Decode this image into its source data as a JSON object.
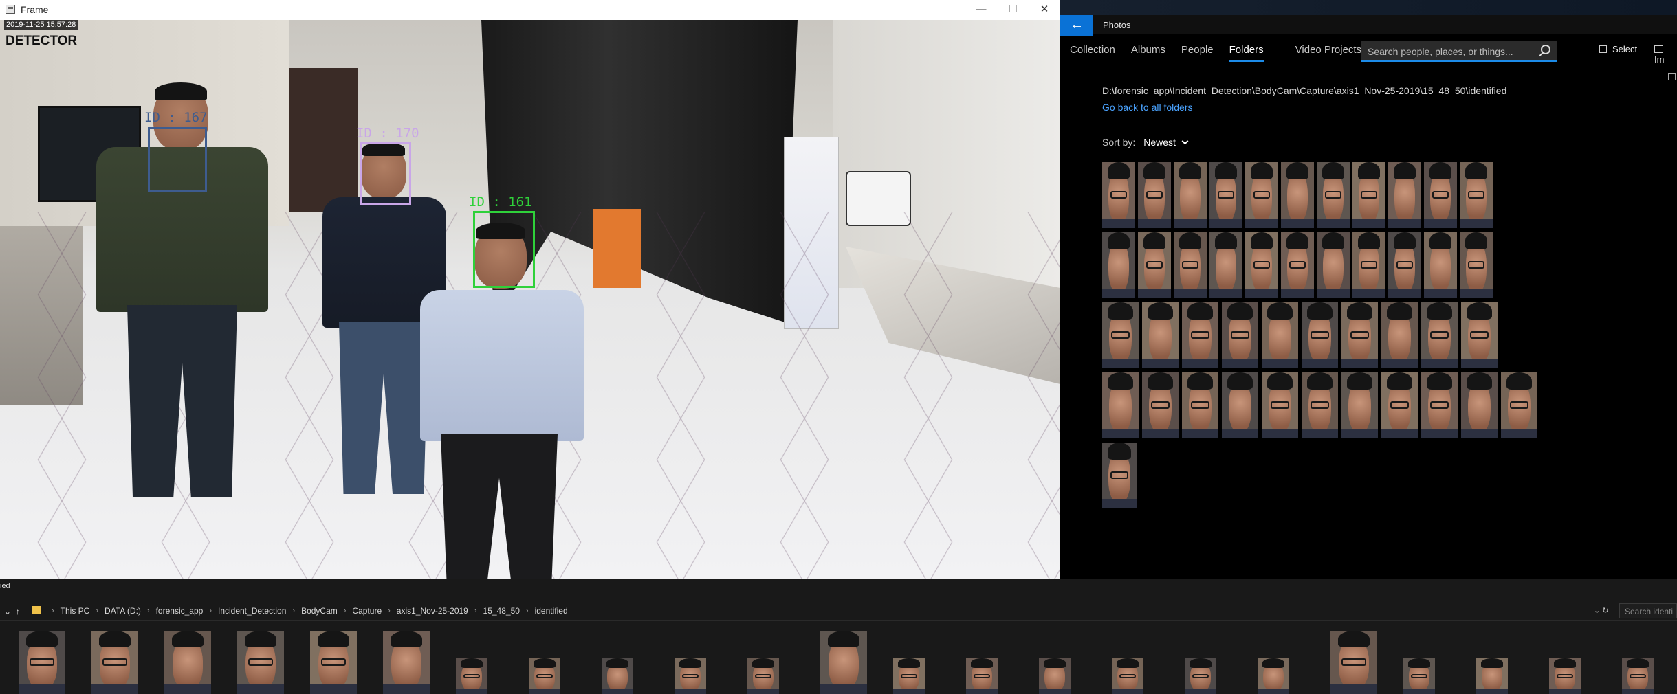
{
  "frame": {
    "title": "Frame",
    "controls": {
      "minimize": "—",
      "maximize": "☐",
      "close": "✕"
    },
    "timestamp": "2019-11-25 15:57:28",
    "detector_label": "DETECTOR",
    "detections": [
      {
        "label": "ID : 167",
        "color": "#3e5c8f"
      },
      {
        "label": "ID : 170",
        "color": "#c9a6e8"
      },
      {
        "label": "ID : 161",
        "color": "#2fd13a"
      }
    ]
  },
  "photos": {
    "app_title": "Photos",
    "back_icon": "←",
    "tabs": [
      "Collection",
      "Albums",
      "People",
      "Folders",
      "Video Projects"
    ],
    "active_tab": "Folders",
    "search_placeholder": "Search people, places, or things...",
    "select_label": "Select",
    "import_label": "Im",
    "folder_path": "D:\\forensic_app\\Incident_Detection\\BodyCam\\Capture\\axis1_Nov-25-2019\\15_48_50\\identified",
    "go_back_link": "Go back to all folders",
    "sort_label": "Sort by:",
    "sort_value": "Newest",
    "thumbnail_rows": [
      11,
      11,
      10,
      11,
      1
    ],
    "total_thumbnails": 44
  },
  "explorer": {
    "title_fragment": "ied",
    "breadcrumbs": [
      "This PC",
      "DATA (D:)",
      "forensic_app",
      "Incident_Detection",
      "BodyCam",
      "Capture",
      "axis1_Nov-25-2019",
      "15_48_50",
      "identified"
    ],
    "search_placeholder": "Search identi",
    "strip_thumbnail_count": 23
  },
  "icons": {
    "back": "arrow-left-icon",
    "search": "search-icon",
    "select": "checkbox-icon",
    "import": "import-icon",
    "folder": "folder-icon",
    "nav_up": "arrow-up-icon",
    "refresh": "refresh-icon"
  },
  "colors": {
    "accent": "#0a72d6",
    "link": "#4aa3ff",
    "photos_bg": "#000000",
    "explorer_bg": "#191919"
  }
}
